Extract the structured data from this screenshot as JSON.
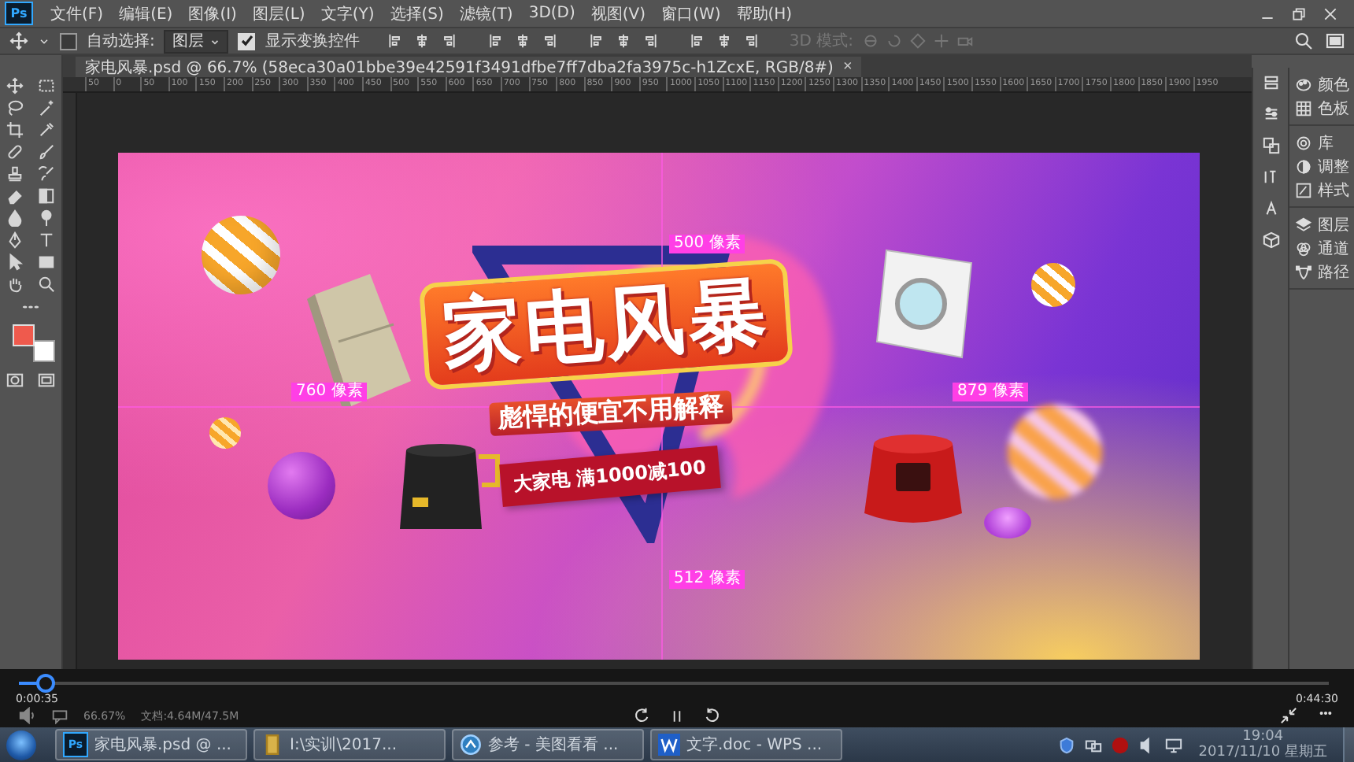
{
  "menu_bar": {
    "logo": "Ps",
    "items": [
      "文件(F)",
      "编辑(E)",
      "图像(I)",
      "图层(L)",
      "文字(Y)",
      "选择(S)",
      "滤镜(T)",
      "3D(D)",
      "视图(V)",
      "窗口(W)",
      "帮助(H)"
    ]
  },
  "options_bar": {
    "auto_select": {
      "label": "自动选择:",
      "checked": false
    },
    "auto_select_target": {
      "value": "图层"
    },
    "show_transform": {
      "label": "显示变换控件",
      "checked": true
    },
    "mode_3d": {
      "label": "3D 模式:",
      "disabled": true
    }
  },
  "document_tab": {
    "title": "家电风暴.psd @ 66.7% (58eca30a01bbe39e42591f3491dfbe7ff7dba2fa3975c-h1ZcxE, RGB/8#)",
    "close": "×"
  },
  "ruler": {
    "ticks": [
      "50",
      "0",
      "50",
      "100",
      "150",
      "200",
      "250",
      "300",
      "350",
      "400",
      "450",
      "500",
      "550",
      "600",
      "650",
      "700",
      "750",
      "800",
      "850",
      "900",
      "950",
      "1000",
      "1050",
      "1100",
      "1150",
      "1200",
      "1250",
      "1300",
      "1350",
      "1400",
      "1450",
      "1500",
      "1550",
      "1600",
      "1650",
      "1700",
      "1750",
      "1800",
      "1850",
      "1900",
      "1950"
    ]
  },
  "banner": {
    "title": "家电风暴",
    "subtitle": "彪悍的便宜不用解释",
    "promo": "大家电 满1000减100",
    "guide_labels": [
      {
        "text": "500 像素"
      },
      {
        "text": "760 像素"
      },
      {
        "text": "879 像素"
      },
      {
        "text": "512 像素"
      }
    ]
  },
  "panels": {
    "groups": [
      [
        {
          "label": "颜色"
        },
        {
          "label": "色板"
        }
      ],
      [
        {
          "label": "库"
        },
        {
          "label": "调整"
        },
        {
          "label": "样式"
        }
      ],
      [
        {
          "label": "图层"
        },
        {
          "label": "通道"
        },
        {
          "label": "路径"
        }
      ]
    ]
  },
  "player": {
    "elapsed": "0:00:35",
    "duration": "0:44:30",
    "level": 0.02,
    "playing": true
  },
  "status_bar": {
    "zoom": "66.67%",
    "document": "文档:4.64M/47.5M"
  },
  "taskbar": {
    "tasks": [
      {
        "kind": "photoshop",
        "badge": "Ps",
        "label": "家电风暴.psd @ ..."
      },
      {
        "kind": "folder",
        "label": "I:\\实训\\2017..."
      },
      {
        "kind": "viewer",
        "label": "参考 - 美图看看 ..."
      },
      {
        "kind": "wps",
        "label": "文字.doc - WPS ..."
      }
    ],
    "clock": {
      "time": "19:04",
      "date": "2017/11/10 星期五"
    }
  }
}
